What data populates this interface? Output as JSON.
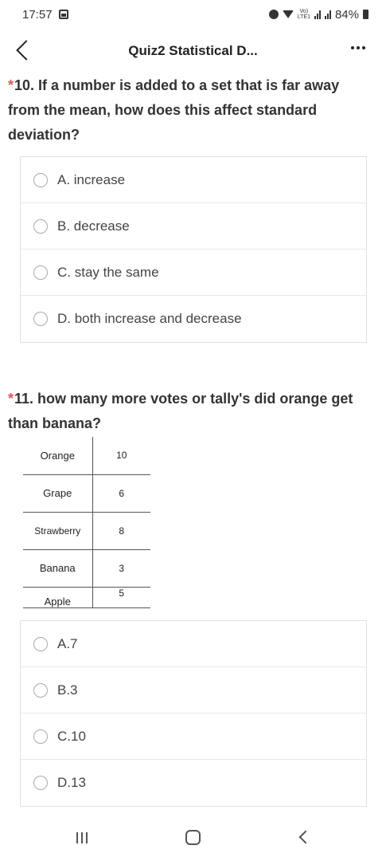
{
  "status_bar": {
    "time": "17:57",
    "volte_top": "Vo)",
    "volte_bottom": "LTE1",
    "battery": "84%"
  },
  "header": {
    "title": "Quiz2 Statistical D..."
  },
  "question10": {
    "required_mark": "*",
    "text": "10. If a number is added to a set that is far away from the mean, how does this affect standard deviation?",
    "options": [
      {
        "label": "A. increase"
      },
      {
        "label": "B. decrease"
      },
      {
        "label": "C. stay the same"
      },
      {
        "label": "D. both increase and decrease"
      }
    ]
  },
  "question11": {
    "required_mark": "*",
    "text": "11. how many more votes or tally's did orange get than banana?",
    "table": [
      {
        "name": "Orange",
        "value": "10"
      },
      {
        "name": "Grape",
        "value": "6"
      },
      {
        "name": "Strawberry",
        "value": "8"
      },
      {
        "name": "Banana",
        "value": "3"
      },
      {
        "name": "Apple",
        "value": "5"
      }
    ],
    "options": [
      {
        "label": "A.7"
      },
      {
        "label": "B.3"
      },
      {
        "label": "C.10"
      },
      {
        "label": "D.13"
      }
    ]
  },
  "icons": {
    "back": "back-arrow-icon",
    "more": "more-dots-icon",
    "nav_recents": "recents-icon",
    "nav_home": "home-icon",
    "nav_back": "nav-back-icon"
  }
}
